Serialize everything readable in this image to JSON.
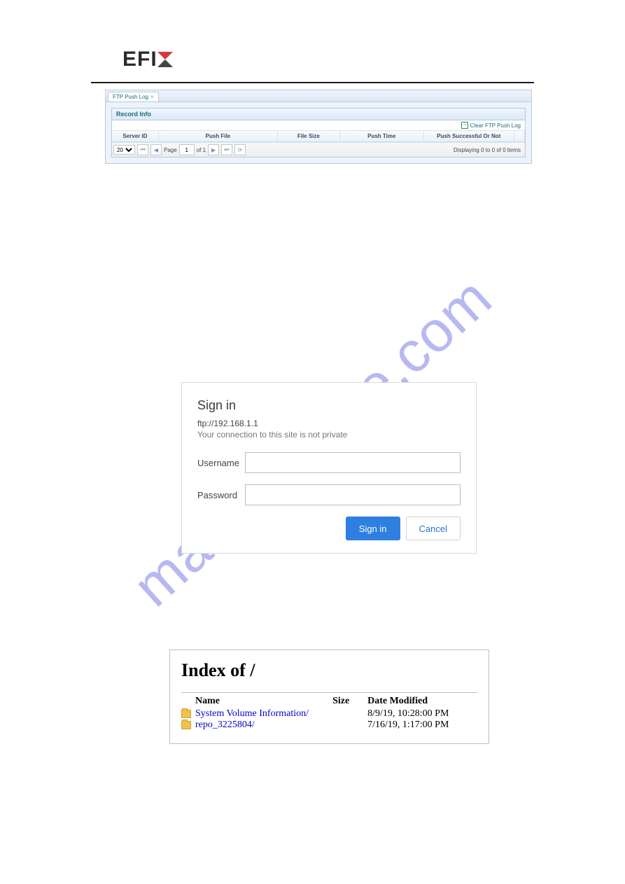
{
  "logo_text": "EFI",
  "watermark": "manualshive.com",
  "ftp": {
    "tab_label": "FTP Push Log",
    "record_title": "Record Info",
    "clear_label": "Clear FTP Push Log",
    "cols": {
      "server": "Server ID",
      "file": "Push File",
      "size": "File Size",
      "time": "Push Time",
      "succ": "Push Successful Or Not"
    },
    "pager": {
      "per_page_value": "20",
      "page_label": "Page",
      "page_value": "1",
      "of_label": "of 1",
      "display": "Displaying 0 to 0 of 0 items"
    }
  },
  "signin": {
    "title": "Sign in",
    "host": "ftp://192.168.1.1",
    "warn": "Your connection to this site is not private",
    "username_label": "Username",
    "password_label": "Password",
    "signin_btn": "Sign in",
    "cancel_btn": "Cancel"
  },
  "index": {
    "title": "Index of /",
    "head": {
      "name": "Name",
      "size": "Size",
      "date": "Date Modified"
    },
    "rows": [
      {
        "name": "System Volume Information/",
        "size": "",
        "date": "8/9/19, 10:28:00 PM"
      },
      {
        "name": "repo_3225804/",
        "size": "",
        "date": "7/16/19, 1:17:00 PM"
      }
    ]
  }
}
